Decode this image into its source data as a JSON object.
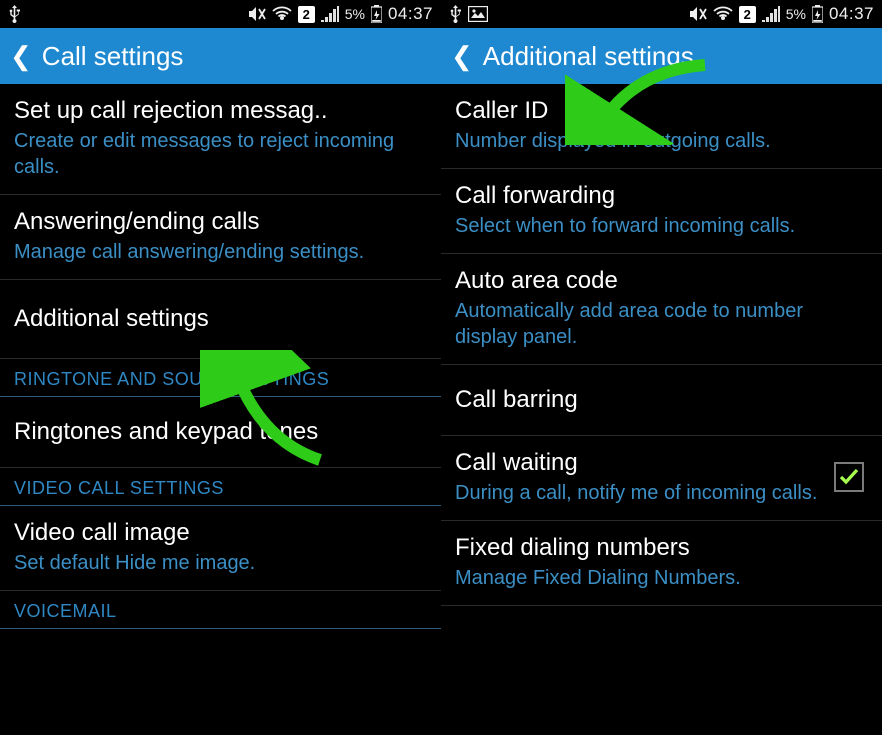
{
  "status": {
    "battery_text": "5%",
    "time": "04:37",
    "sim_number": "2"
  },
  "left": {
    "title": "Call settings",
    "items": {
      "reject_msg_title": "Set up call rejection messag..",
      "reject_msg_sub": "Create or edit messages to reject incoming calls.",
      "answer_end_title": "Answering/ending calls",
      "answer_end_sub": "Manage call answering/ending settings.",
      "additional_title": "Additional settings"
    },
    "sections": {
      "ringtone": "RINGTONE AND SOUND SETTINGS",
      "video": "VIDEO CALL SETTINGS",
      "voicemail": "VOICEMAIL"
    },
    "ringtones_title": "Ringtones and keypad tones",
    "video_img_title": "Video call image",
    "video_img_sub": "Set default Hide me image."
  },
  "right": {
    "title": "Additional settings",
    "caller_id_title": "Caller ID",
    "caller_id_sub": "Number displayed in outgoing calls.",
    "forwarding_title": "Call forwarding",
    "forwarding_sub": "Select when to forward incoming calls.",
    "auto_area_title": "Auto area code",
    "auto_area_sub": "Automatically add area code to number display panel.",
    "barring_title": "Call barring",
    "waiting_title": "Call waiting",
    "waiting_sub": "During a call, notify me of incoming calls.",
    "fdn_title": "Fixed dialing numbers",
    "fdn_sub": "Manage Fixed Dialing Numbers."
  }
}
